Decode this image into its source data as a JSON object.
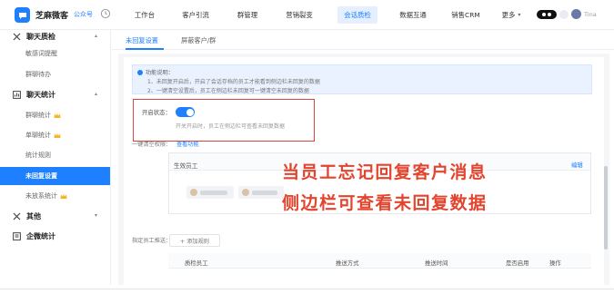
{
  "header": {
    "brand": "芝麻微客",
    "brand_sub": "公众号",
    "nav": [
      {
        "label": "工作台",
        "active": false,
        "has_chevron": false
      },
      {
        "label": "客户引流",
        "active": false,
        "has_chevron": false
      },
      {
        "label": "群管理",
        "active": false,
        "has_chevron": false
      },
      {
        "label": "营销裂变",
        "active": false,
        "has_chevron": false
      },
      {
        "label": "会话质检",
        "active": true,
        "has_chevron": false
      },
      {
        "label": "数据互通",
        "active": false,
        "has_chevron": false
      },
      {
        "label": "销售CRM",
        "active": false,
        "has_chevron": false
      },
      {
        "label": "更多",
        "active": false,
        "has_chevron": true
      }
    ],
    "user_name": "Tina",
    "accent": "#1e80ff"
  },
  "sidebar": {
    "groups": [
      {
        "label": "聊天质检",
        "icon": "inspect-icon",
        "items": [
          "敏感词提醒",
          "群聊待办"
        ]
      },
      {
        "label": "聊天统计",
        "icon": "chart-icon",
        "items": [
          "群聊统计",
          "单聊统计",
          "统计规则",
          "未回复设置",
          "未放系统计"
        ]
      },
      {
        "label": "其他",
        "icon": "other-icon",
        "items": []
      },
      {
        "label": "企微统计",
        "icon": "wecom-icon",
        "items": []
      }
    ],
    "active_item": "未回复设置",
    "crown_items": [
      "群聊统计",
      "单聊统计",
      "未放系统计"
    ]
  },
  "tabs": [
    "未回复设置",
    "屏蔽客户/群"
  ],
  "notice": {
    "title": "功能说明：",
    "lines": [
      "1、未回复开启后，开启了会话存档的员工才能看到侧边栏未回复的数据",
      "2、一键清空设置后，员工在侧边栏未回复可一键清空未回复的数据"
    ]
  },
  "switch": {
    "label": "开启状态：",
    "on": true,
    "desc": "开关开启时，员工在侧边栏可查看未回复数据"
  },
  "quick_clear": {
    "label": "一键清空权限：",
    "link": "查看功能"
  },
  "staff": {
    "title": "生效员工",
    "edit": "编辑"
  },
  "overlay": {
    "line1": "当员工忘记回复客户消息",
    "line2": "侧边栏可查看未回复数据",
    "color": "#e3442e"
  },
  "rules": {
    "label": "指定员工推送：",
    "add_button": "+ 添加规则",
    "columns": [
      "质检员工",
      "推送方式",
      "推送时间",
      "是否启用",
      "操作"
    ]
  }
}
